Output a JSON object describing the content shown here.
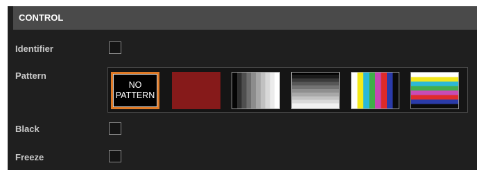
{
  "header": {
    "title": "CONTROL"
  },
  "rows": {
    "identifier": {
      "label": "Identifier",
      "checked": false
    },
    "pattern": {
      "label": "Pattern"
    },
    "black": {
      "label": "Black",
      "checked": false
    },
    "freeze": {
      "label": "Freeze",
      "checked": false
    }
  },
  "patterns": {
    "selected": "no-pattern",
    "items": [
      {
        "id": "no-pattern",
        "label": "NO\nPATTERN"
      },
      {
        "id": "red"
      },
      {
        "id": "vertical-gray-ramp"
      },
      {
        "id": "horizontal-gray-ramp"
      },
      {
        "id": "vertical-color-bars"
      },
      {
        "id": "horizontal-color-bars"
      }
    ]
  },
  "colors": {
    "background": "#1f1f1f",
    "header": "#4a4a4a",
    "selection": "#e07a26"
  }
}
